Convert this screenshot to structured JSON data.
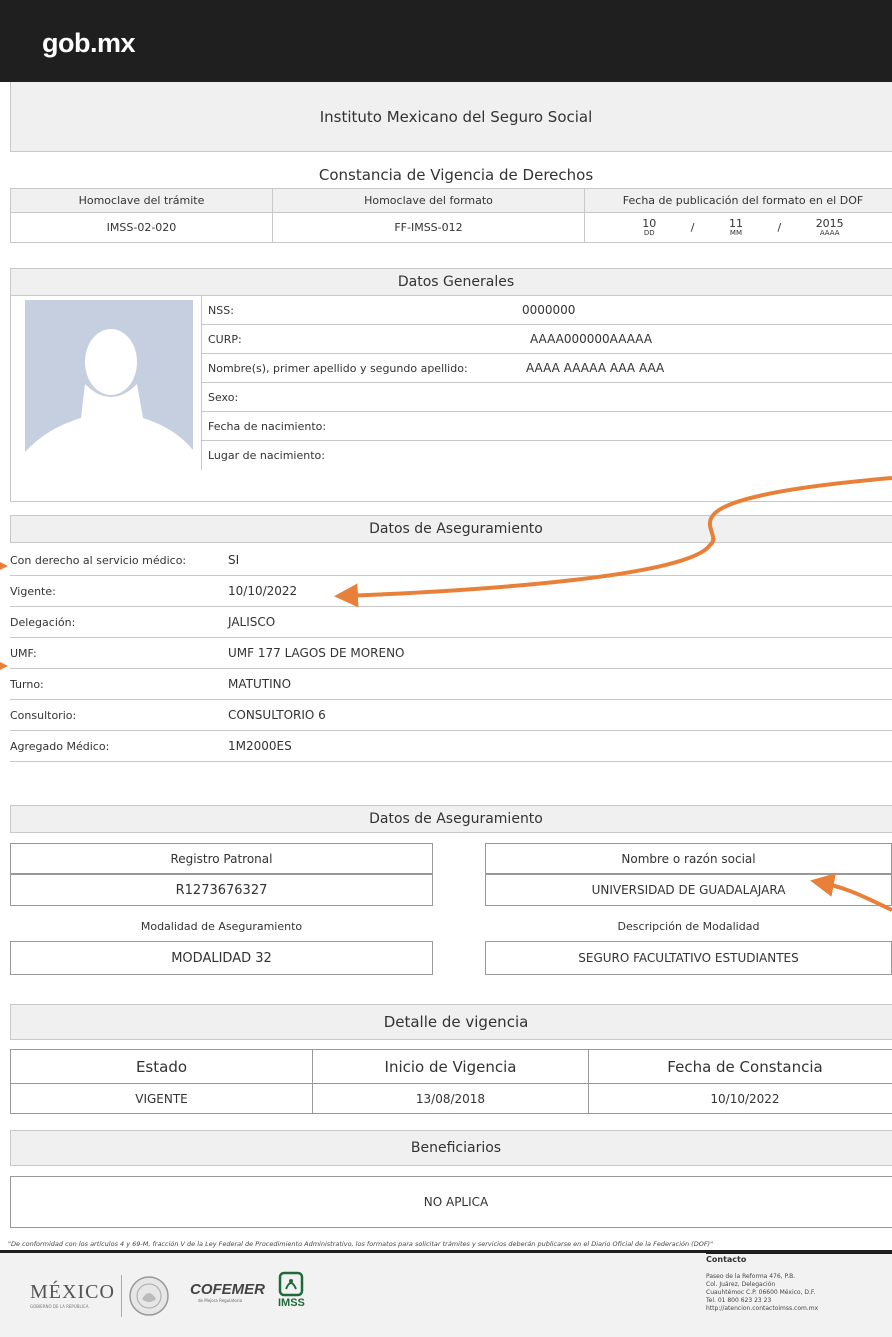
{
  "header": {
    "logo": "gob.mx",
    "institute": "Instituto Mexicano del Seguro Social"
  },
  "document": {
    "title": "Constancia de Vigencia de Derechos",
    "homoclave": {
      "headers": [
        "Homoclave del trámite",
        "Homoclave del formato",
        "Fecha de publicación del formato en el DOF"
      ],
      "tramite": "IMSS-02-020",
      "formato": "FF-IMSS-012",
      "fecha": {
        "dd": "10",
        "mm": "11",
        "aaaa": "2015",
        "dd_label": "DD",
        "mm_label": "MM",
        "aaaa_label": "AAAA",
        "sep": "/"
      }
    }
  },
  "datos_generales": {
    "title": "Datos Generales",
    "rows": [
      {
        "label": "NSS:",
        "value": "0000000"
      },
      {
        "label": "CURP:",
        "value": "AAAA000000AAAAA"
      },
      {
        "label": "Nombre(s), primer apellido y segundo apellido:",
        "value": "AAAA AAAAA AAA AAA"
      },
      {
        "label": "Sexo:",
        "value": ""
      },
      {
        "label": "Fecha de nacimiento:",
        "value": ""
      },
      {
        "label": "Lugar de nacimiento:",
        "value": ""
      }
    ]
  },
  "datos_aseguramiento": {
    "title": "Datos de Aseguramiento",
    "rows": [
      {
        "label": "Con derecho al servicio médico:",
        "value": "SI"
      },
      {
        "label": "Vigente:",
        "value": "10/10/2022"
      },
      {
        "label": "Delegación:",
        "value": "JALISCO"
      },
      {
        "label": "UMF:",
        "value": "UMF 177 LAGOS DE MORENO"
      },
      {
        "label": "Turno:",
        "value": "MATUTINO"
      },
      {
        "label": "Consultorio:",
        "value": "CONSULTORIO 6"
      },
      {
        "label": "Agregado Médico:",
        "value": "1M2000ES"
      }
    ]
  },
  "datos_aseguramiento_2": {
    "title": "Datos de Aseguramiento",
    "registro_patronal_label": "Registro Patronal",
    "registro_patronal": "R1273676327",
    "razon_social_label": "Nombre o razón social",
    "razon_social": "UNIVERSIDAD DE GUADALAJARA",
    "modalidad_label": "Modalidad de Aseguramiento",
    "modalidad": "MODALIDAD 32",
    "descripcion_label": "Descripción de Modalidad",
    "descripcion": "SEGURO FACULTATIVO ESTUDIANTES"
  },
  "detalle_vigencia": {
    "title": "Detalle de vigencia",
    "headers": [
      "Estado",
      "Inicio de Vigencia",
      "Fecha de Constancia"
    ],
    "values": [
      "VIGENTE",
      "13/08/2018",
      "10/10/2022"
    ]
  },
  "beneficiarios": {
    "title": "Beneficiarios",
    "value": "NO APLICA"
  },
  "footer": {
    "legal": "\"De conformidad con los artículos 4 y 69-M, fracción V de la Ley Federal de Procedimiento Administrativo, los formatos para solicitar trámites y servicios deberán publicarse en el Diario Oficial de la Federación (DOF)\"",
    "logo_mexico": "MÉXICO",
    "logo_mexico_sub": "GOBIERNO DE LA REPÚBLICA",
    "logo_cofemer": "COFEMER",
    "logo_cofemer_sub": "de Mejora Regulatoria",
    "logo_imss": "IMSS",
    "contact_title": "Contacto",
    "contact_lines": [
      "Paseo de la Reforma 476, P.B.",
      "Col. Juárez, Delegación",
      "Cuauhtémoc C.P. 06600 México, D.F.",
      "Tel. 01 800 623 23 23",
      "http://atencion.contactoimss.com.mx"
    ]
  },
  "colors": {
    "header_bg": "#1f1f1f",
    "section_bg": "#f0f0f0",
    "annotation_arrow": "#e8803a",
    "photo_bg": "#c5cfdf"
  }
}
